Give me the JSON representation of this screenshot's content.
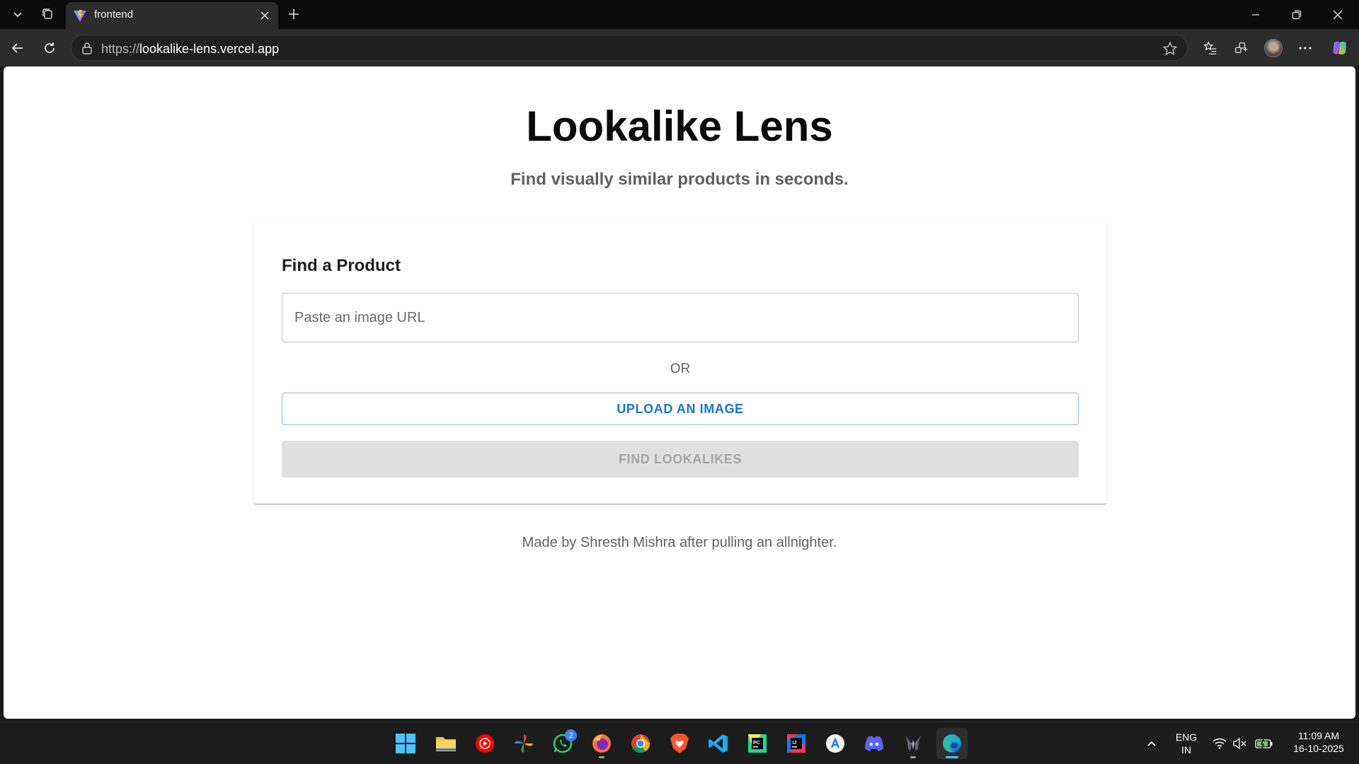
{
  "browser": {
    "tab_title": "frontend",
    "url_protocol": "https://",
    "url_host": "lookalike-lens.vercel.app"
  },
  "page": {
    "title": "Lookalike Lens",
    "subtitle": "Find visually similar products in seconds.",
    "card": {
      "title": "Find a Product",
      "url_placeholder": "Paste an image URL",
      "url_value": "",
      "or_label": "OR",
      "upload_label": "UPLOAD AN IMAGE",
      "find_label": "FIND LOOKALIKES",
      "find_disabled": true
    },
    "footer": "Made by Shresth Mishra after pulling an allnighter."
  },
  "colors": {
    "primary": "#1976d2",
    "disabled_bg": "#e0e0e0",
    "disabled_text": "#a5a5a5"
  },
  "taskbar": {
    "apps": [
      "start-icon",
      "file-explorer-icon",
      "youtube-music-icon",
      "photos-icon",
      "whatsapp-icon",
      "firefox-icon",
      "chrome-icon",
      "brave-icon",
      "vscode-icon",
      "pycharm-icon",
      "intellij-icon",
      "app-store-icon",
      "discord-icon",
      "predator-sense-icon",
      "edge-icon"
    ],
    "whatsapp_badge": "2",
    "lang_line1": "ENG",
    "lang_line2": "IN",
    "time": "11:09 AM",
    "date": "16-10-2025"
  }
}
